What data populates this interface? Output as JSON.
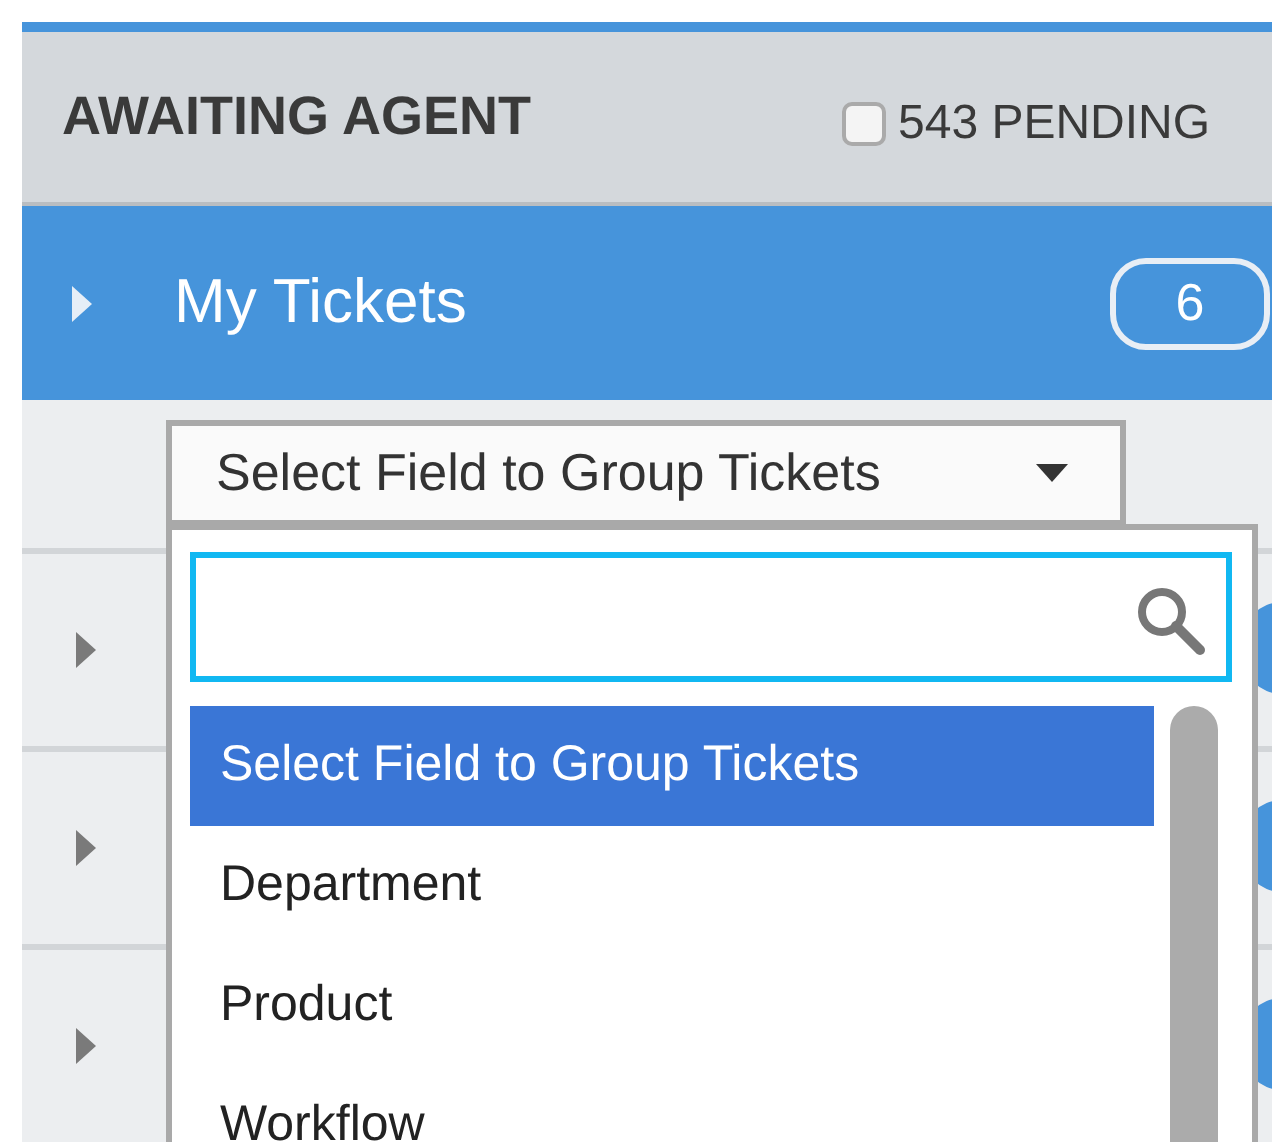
{
  "header": {
    "title": "AWAITING AGENT",
    "pending": {
      "label": "543 PENDING",
      "checked": false
    }
  },
  "my_tickets": {
    "label": "My Tickets",
    "count": "6",
    "expanded": false
  },
  "group_select": {
    "value": "Select Field to Group Tickets",
    "options": [
      {
        "label": "Select Field to Group Tickets",
        "selected": true
      },
      {
        "label": "Department",
        "selected": false
      },
      {
        "label": "Product",
        "selected": false
      },
      {
        "label": "Workflow",
        "selected": false
      }
    ]
  }
}
